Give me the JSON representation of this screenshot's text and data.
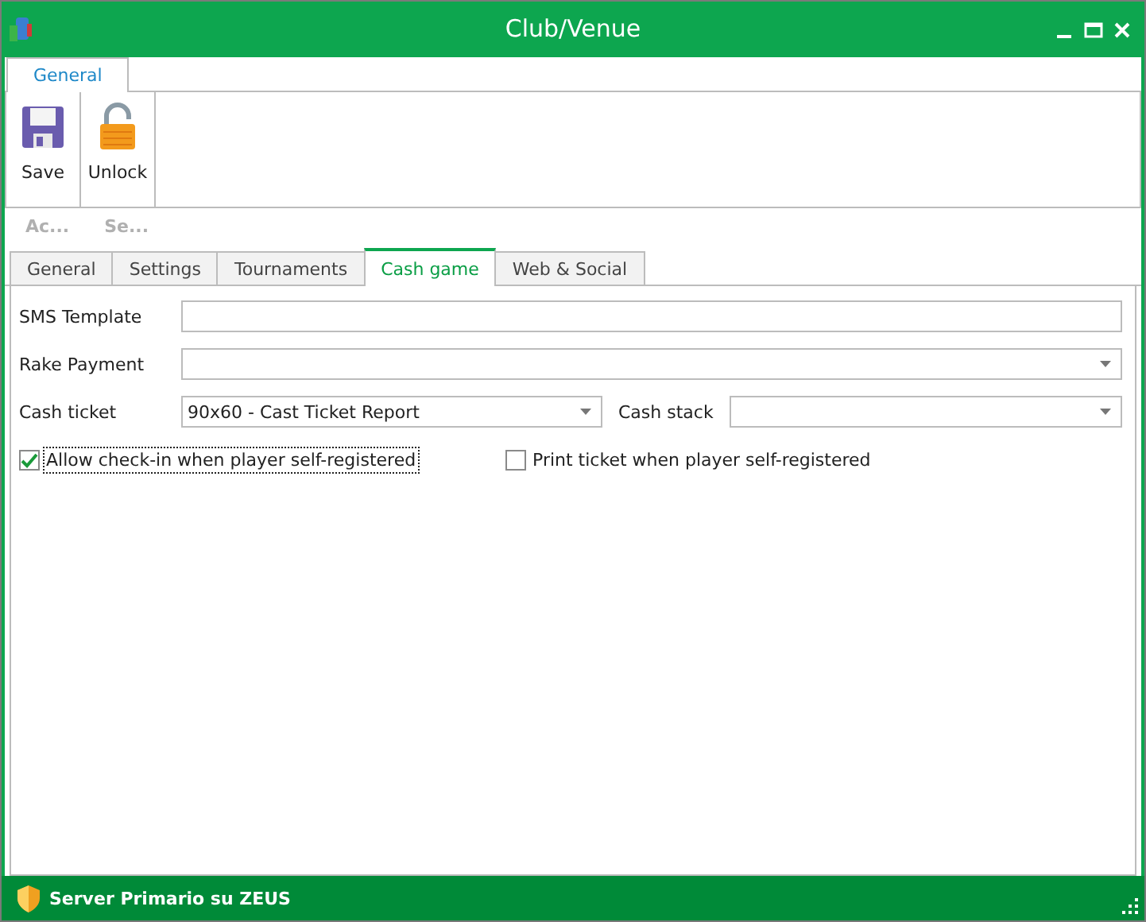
{
  "window": {
    "title": "Club/Venue"
  },
  "ribbon": {
    "tabs": [
      {
        "label": "General",
        "selected": true
      }
    ],
    "buttons": [
      {
        "label": "Save",
        "kind": "save"
      },
      {
        "label": "Unlock",
        "kind": "unlock"
      }
    ],
    "groups": [
      "Ac...",
      "Se..."
    ]
  },
  "tabs": [
    {
      "label": "General",
      "selected": false
    },
    {
      "label": "Settings",
      "selected": false
    },
    {
      "label": "Tournaments",
      "selected": false
    },
    {
      "label": "Cash game",
      "selected": true
    },
    {
      "label": "Web & Social",
      "selected": false
    }
  ],
  "form_rows": [
    {
      "fields": [
        {
          "label": "SMS Template",
          "kind": "text"
        }
      ]
    },
    {
      "fields": [
        {
          "label": "Rake Payment",
          "kind": "dropdown"
        }
      ]
    },
    {
      "fields": [
        {
          "label": "Cash ticket",
          "kind": "dropdown",
          "value": "90x60 - Cast Ticket Report"
        },
        {
          "label": "Cash stack",
          "kind": "dropdown"
        }
      ]
    }
  ],
  "checkboxes": [
    {
      "label": "Allow check-in when player self-registered",
      "checked": true,
      "focused": true
    },
    {
      "label": "Print ticket when player self-registered",
      "checked": false,
      "focused": false
    }
  ],
  "status_bar": {
    "text": "Server Primario su ZEUS"
  }
}
